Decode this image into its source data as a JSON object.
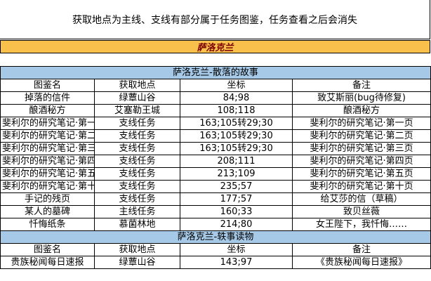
{
  "header": {
    "note": "获取地点为主线、支线有部分属于任务图鉴，任务查看之后会消失"
  },
  "region": {
    "name": "萨洛克兰"
  },
  "columns": [
    "图鉴名",
    "获取地点",
    "坐标",
    "备注"
  ],
  "sections": [
    {
      "title": "萨洛克兰-散落的故事",
      "rows": [
        [
          "掉落的信件",
          "绿蕈山谷",
          "84;98",
          "致艾斯丽(bug待修复)"
        ],
        [
          "酿酒秘方",
          "艾塞勒王城",
          "108;118",
          "酿酒秘方"
        ],
        [
          "斐利尔的研究笔记·第一页",
          "支线任务",
          "163;105转29;30",
          "斐利尔的研究笔记·第一页"
        ],
        [
          "斐利尔的研究笔记·第二页",
          "支线任务",
          "163;105转29;30",
          "斐利尔的研究笔记·第二页"
        ],
        [
          "斐利尔的研究笔记·第三页",
          "支线任务",
          "163;105转29;30",
          "斐利尔的研究笔记·第三页"
        ],
        [
          "斐利尔的研究笔记·第四页",
          "支线任务",
          "208;111",
          "斐利尔的研究笔记·第四页"
        ],
        [
          "斐利尔的研究笔记·第五页",
          "支线任务",
          "213;109",
          "斐利尔的研究笔记·第五页"
        ],
        [
          "斐利尔的研究笔记·第十页",
          "支线任务",
          "235;57",
          "斐利尔的研究笔记·第十页"
        ],
        [
          "手记的残页",
          "支线任务",
          "177;57",
          "给艾莎的信（草稿）"
        ],
        [
          "某人的墓碑",
          "主线任务",
          "160;33",
          "致贝丝薇"
        ],
        [
          "忏悔纸条",
          "慕菌林地",
          "214;80",
          "女王陛下，我忏悔……"
        ]
      ]
    },
    {
      "title": "萨洛克兰-轶事读物",
      "rows": [
        [
          "贵族秘闻每日速报",
          "绿蕈山谷",
          "143;97",
          "《贵族秘闻每日速报》"
        ]
      ]
    }
  ]
}
